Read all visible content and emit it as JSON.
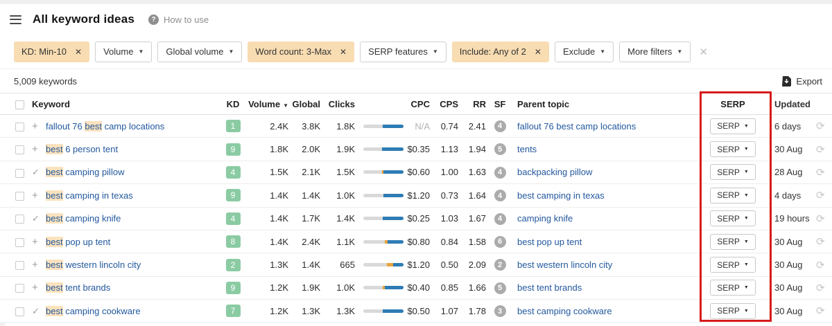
{
  "header": {
    "title": "All keyword ideas",
    "help_label": "How to use"
  },
  "filters": {
    "chips": [
      {
        "label": "KD: Min-10",
        "type": "active"
      },
      {
        "label": "Volume",
        "type": "dropdown"
      },
      {
        "label": "Global volume",
        "type": "dropdown"
      },
      {
        "label": "Word count: 3-Max",
        "type": "active"
      },
      {
        "label": "SERP features",
        "type": "dropdown"
      },
      {
        "label": "Include: Any of 2",
        "type": "active"
      },
      {
        "label": "Exclude",
        "type": "dropdown"
      },
      {
        "label": "More filters",
        "type": "dropdown"
      }
    ],
    "remove_icon": "✕",
    "clear_all_icon": "✕"
  },
  "toolbar": {
    "count": "5,009 keywords",
    "export_label": "Export"
  },
  "table": {
    "columns": [
      "Keyword",
      "KD",
      "Volume",
      "Global",
      "Clicks",
      "CPC",
      "CPS",
      "RR",
      "SF",
      "Parent topic",
      "SERP",
      "Updated"
    ],
    "serp_button_label": "SERP",
    "rows": [
      {
        "icon": "plus",
        "kw_pre": "fallout 76 ",
        "kw_hl": "best",
        "kw_post": " camp locations",
        "kd": "1",
        "volume": "2.4K",
        "global": "3.8K",
        "clicks": "1.8K",
        "bar": {
          "orange": 0,
          "blue": 52
        },
        "cpc": "N/A",
        "cps": "0.74",
        "rr": "2.41",
        "sf": "4",
        "parent": "fallout 76 best camp locations",
        "updated": "6 days"
      },
      {
        "icon": "plus",
        "kw_pre": "",
        "kw_hl": "best",
        "kw_post": " 6 person tent",
        "kd": "9",
        "volume": "1.8K",
        "global": "2.0K",
        "clicks": "1.9K",
        "bar": {
          "orange": 0,
          "blue": 54
        },
        "cpc": "$0.35",
        "cps": "1.13",
        "rr": "1.94",
        "sf": "5",
        "parent": "tents",
        "updated": "30 Aug"
      },
      {
        "icon": "check",
        "kw_pre": "",
        "kw_hl": "best",
        "kw_post": " camping pillow",
        "kd": "4",
        "volume": "1.5K",
        "global": "2.1K",
        "clicks": "1.5K",
        "bar": {
          "orange": 4,
          "blue": 50
        },
        "cpc": "$0.60",
        "cps": "1.00",
        "rr": "1.63",
        "sf": "4",
        "parent": "backpacking pillow",
        "updated": "28 Aug"
      },
      {
        "icon": "plus",
        "kw_pre": "",
        "kw_hl": "best",
        "kw_post": " camping in texas",
        "kd": "9",
        "volume": "1.4K",
        "global": "1.4K",
        "clicks": "1.0K",
        "bar": {
          "orange": 0,
          "blue": 50
        },
        "cpc": "$1.20",
        "cps": "0.73",
        "rr": "1.64",
        "sf": "4",
        "parent": "best camping in texas",
        "updated": "4 days"
      },
      {
        "icon": "check",
        "kw_pre": "",
        "kw_hl": "best",
        "kw_post": " camping knife",
        "kd": "4",
        "volume": "1.4K",
        "global": "1.7K",
        "clicks": "1.4K",
        "bar": {
          "orange": 0,
          "blue": 52
        },
        "cpc": "$0.25",
        "cps": "1.03",
        "rr": "1.67",
        "sf": "4",
        "parent": "camping knife",
        "updated": "19 hours"
      },
      {
        "icon": "plus",
        "kw_pre": "",
        "kw_hl": "best",
        "kw_post": " pop up tent",
        "kd": "8",
        "volume": "1.4K",
        "global": "2.4K",
        "clicks": "1.1K",
        "bar": {
          "orange": 6,
          "blue": 40
        },
        "cpc": "$0.80",
        "cps": "0.84",
        "rr": "1.58",
        "sf": "6",
        "parent": "best pop up tent",
        "updated": "30 Aug"
      },
      {
        "icon": "plus",
        "kw_pre": "",
        "kw_hl": "best",
        "kw_post": " western lincoln city",
        "kd": "2",
        "volume": "1.3K",
        "global": "1.4K",
        "clicks": "665",
        "bar": {
          "orange": 16,
          "blue": 26
        },
        "cpc": "$1.20",
        "cps": "0.50",
        "rr": "2.09",
        "sf": "2",
        "parent": "best western lincoln city",
        "updated": "30 Aug"
      },
      {
        "icon": "plus",
        "kw_pre": "",
        "kw_hl": "best",
        "kw_post": " tent brands",
        "kd": "9",
        "volume": "1.2K",
        "global": "1.9K",
        "clicks": "1.0K",
        "bar": {
          "orange": 5,
          "blue": 46
        },
        "cpc": "$0.40",
        "cps": "0.85",
        "rr": "1.66",
        "sf": "5",
        "parent": "best tent brands",
        "updated": "30 Aug"
      },
      {
        "icon": "check",
        "kw_pre": "",
        "kw_hl": "best",
        "kw_post": " camping cookware",
        "kd": "7",
        "volume": "1.2K",
        "global": "1.3K",
        "clicks": "1.3K",
        "bar": {
          "orange": 0,
          "blue": 52
        },
        "cpc": "$0.50",
        "cps": "1.07",
        "rr": "1.78",
        "sf": "3",
        "parent": "best camping cookware",
        "updated": "30 Aug"
      }
    ]
  },
  "colors": {
    "chip_active_bg": "#f8dcb2",
    "link_blue": "#22589e",
    "kd_badge_green": "#8bcba3",
    "bar_blue": "#2e7cb5",
    "bar_orange": "#e8a33f",
    "bar_track": "#d9d9d9",
    "sf_badge_gray": "#ababab",
    "highlight_bg": "#fbe2bd",
    "serp_highlight_red": "#d71a1a"
  }
}
